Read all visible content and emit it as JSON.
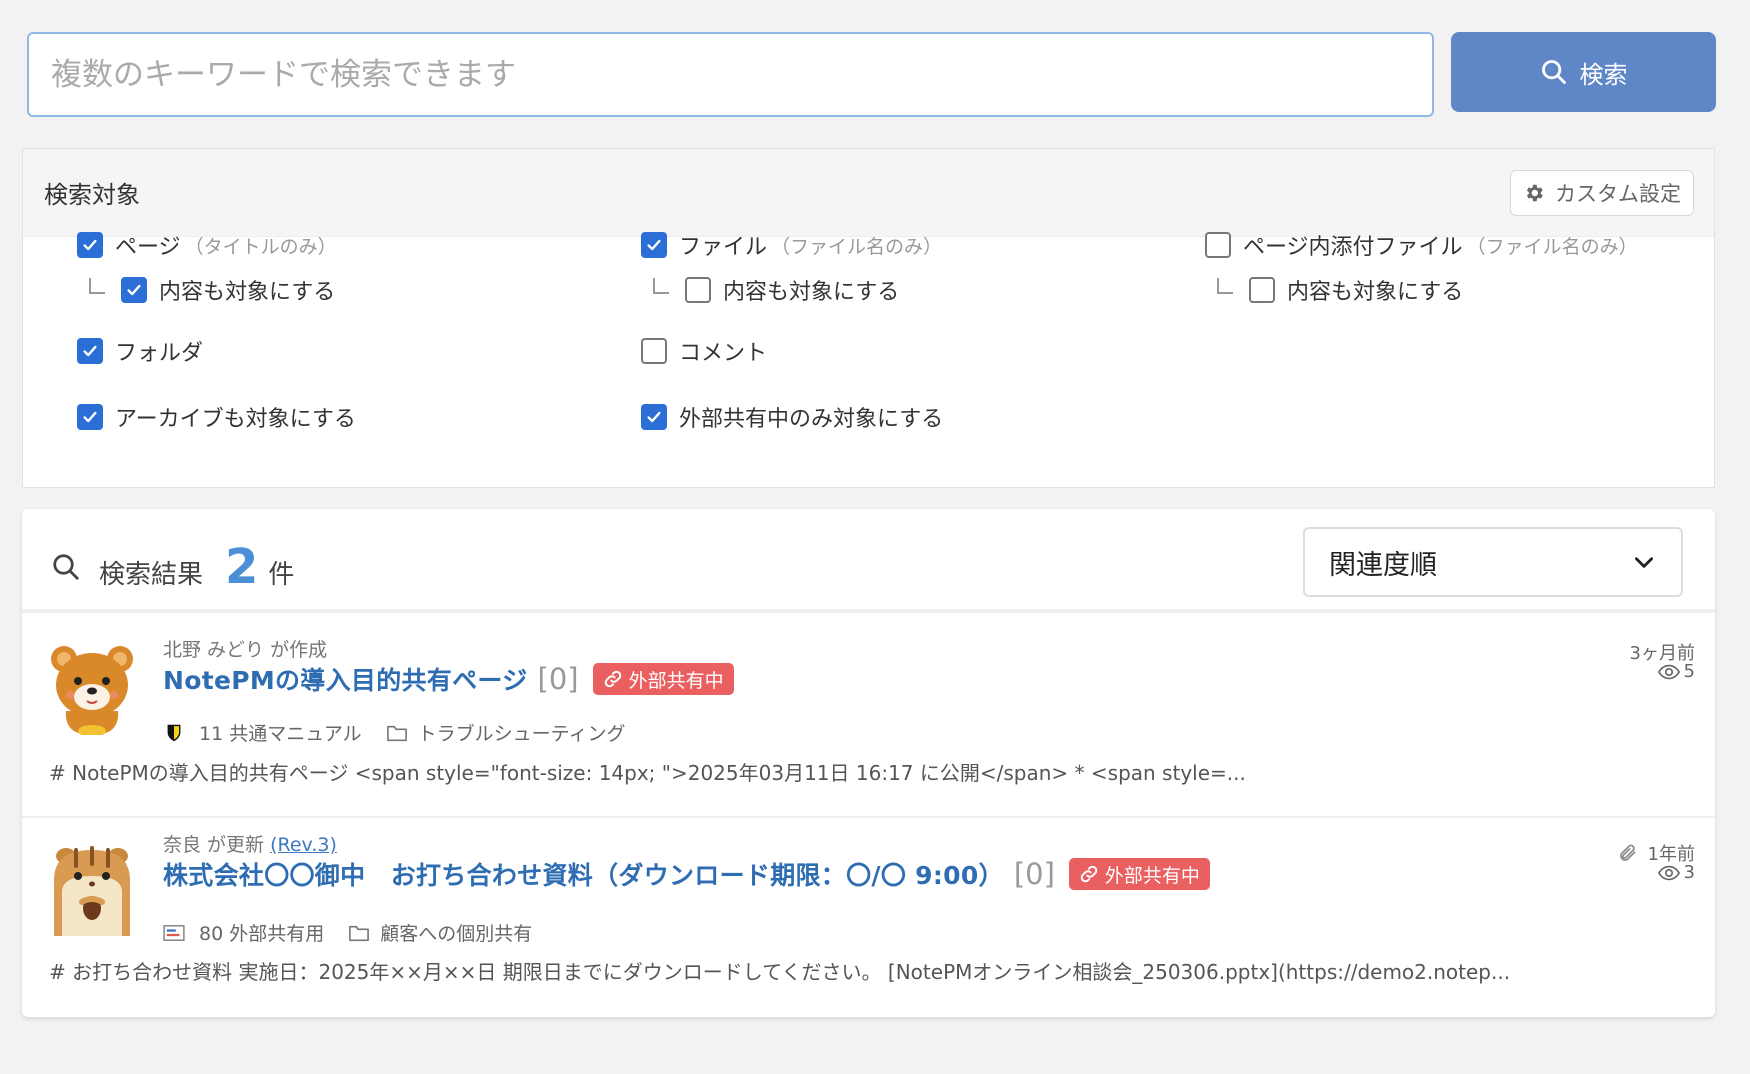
{
  "search": {
    "placeholder": "複数のキーワードで検索できます",
    "button_label": "検索"
  },
  "target": {
    "title": "検索対象",
    "custom_label": "カスタム設定",
    "options": {
      "page": {
        "label": "ページ",
        "note": "（タイトルのみ）",
        "checked": true
      },
      "page_content": {
        "label": "内容も対象にする",
        "checked": true
      },
      "file": {
        "label": "ファイル",
        "note": "（ファイル名のみ）",
        "checked": true
      },
      "file_content": {
        "label": "内容も対象にする",
        "checked": false
      },
      "attachment": {
        "label": "ページ内添付ファイル",
        "note": "（ファイル名のみ）",
        "checked": false
      },
      "attachment_content": {
        "label": "内容も対象にする",
        "checked": false
      },
      "folder": {
        "label": "フォルダ",
        "checked": true
      },
      "comment": {
        "label": "コメント",
        "checked": false
      },
      "archive": {
        "label": "アーカイブも対象にする",
        "checked": true
      },
      "external_only": {
        "label": "外部共有中のみ対象にする",
        "checked": true
      }
    }
  },
  "results": {
    "label": "検索結果",
    "count": "2",
    "unit": "件",
    "sort_selected": "関連度順",
    "items": [
      {
        "meta": "北野 みどり が作成",
        "rev": "",
        "title": "NotePMの導入目的共有ページ",
        "comments": "[0]",
        "badge": "外部共有中",
        "note_name": "11 共通マニュアル",
        "folder": "トラブルシューティング",
        "excerpt": "# NotePMの導入目的共有ページ <span style=\"font-size: 14px; \">2025年03月11日 16:17 に公開</span> * <span style=...",
        "time": "3ヶ月前",
        "views": "5",
        "has_attachment": false
      },
      {
        "meta": "奈良 が更新",
        "rev": "(Rev.3)",
        "title": "株式会社〇〇御中　お打ち合わせ資料（ダウンロード期限：〇/〇 9:00）",
        "comments": "[0]",
        "badge": "外部共有中",
        "note_name": "80 外部共有用",
        "folder": "顧客への個別共有",
        "excerpt": "# お打ち合わせ資料 実施日：2025年××月××日 期限日までにダウンロードしてください。 [NotePMオンライン相談会_250306.pptx](https://demo2.notep...",
        "time": "1年前",
        "views": "3",
        "has_attachment": true
      }
    ]
  },
  "colors": {
    "accent": "#5f86c7",
    "link": "#2f6db3",
    "badge": "#ea5f5f",
    "checkbox": "#2b6fd6"
  }
}
